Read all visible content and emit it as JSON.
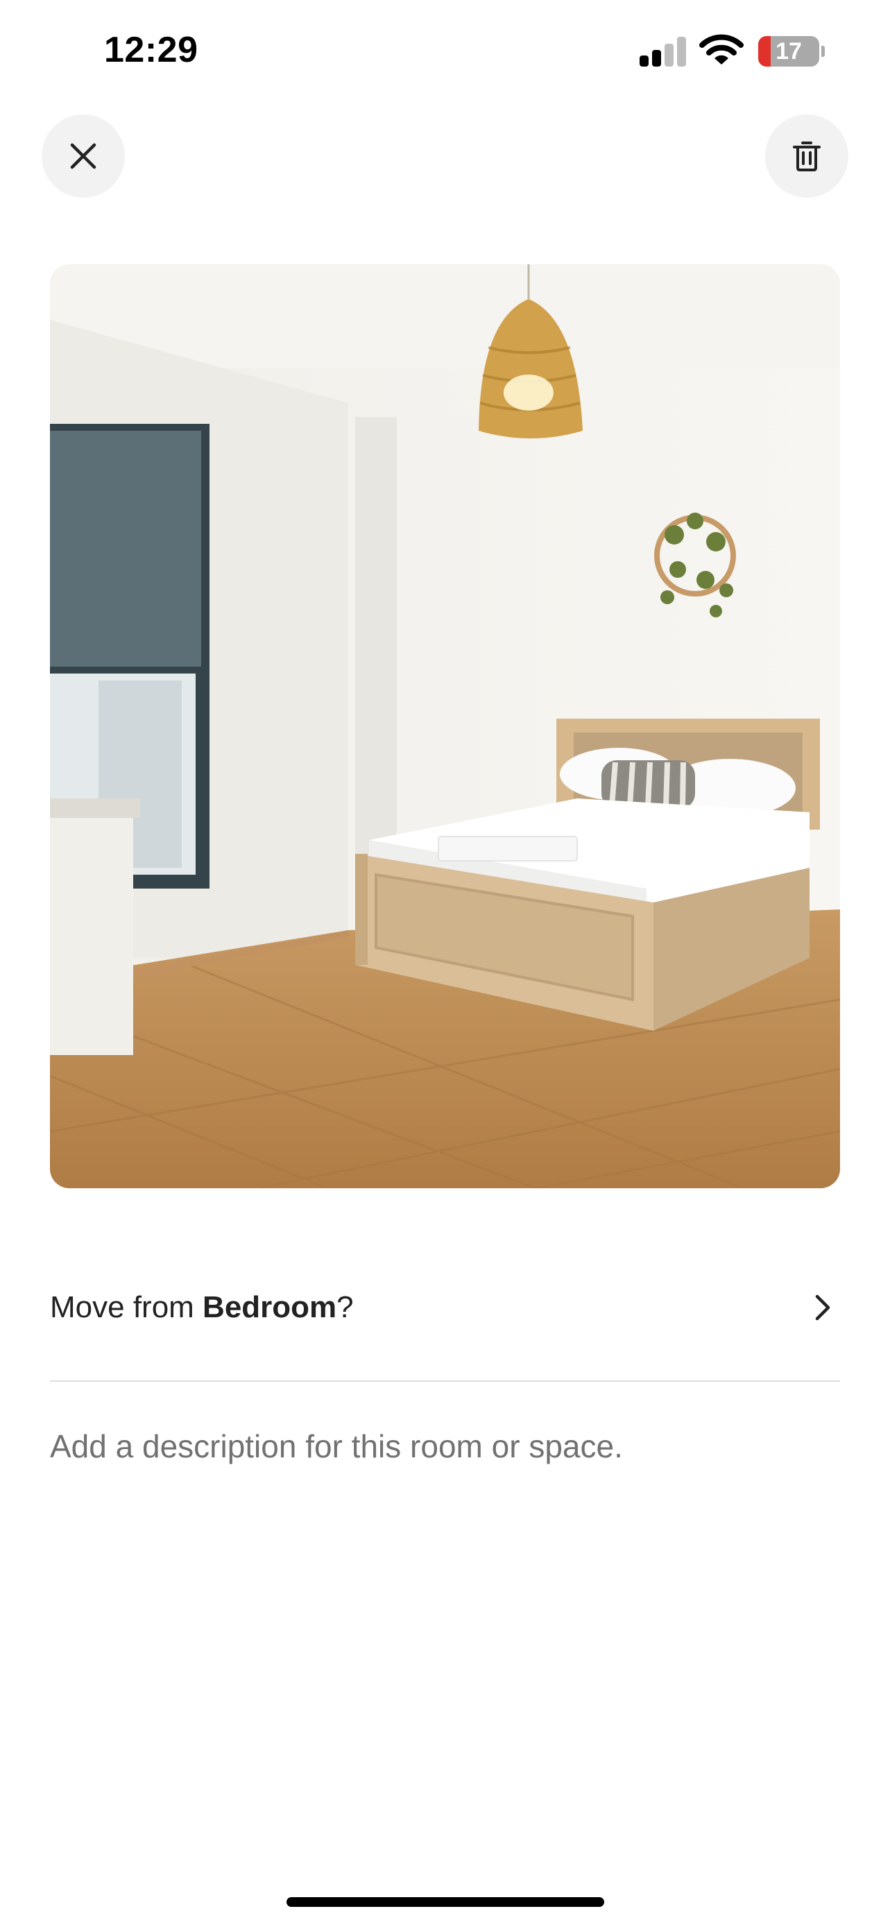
{
  "status_bar": {
    "time": "12:29",
    "battery_level": "17",
    "battery_fraction": 0.17,
    "signal_bars_active": 2,
    "signal_bars_total": 4
  },
  "header": {
    "close_icon": "close-icon",
    "delete_icon": "trash-icon"
  },
  "photo": {
    "subject": "bedroom"
  },
  "move_row": {
    "prefix": "Move from ",
    "room": "Bedroom",
    "suffix": "?",
    "chevron_icon": "chevron-right-icon"
  },
  "description": {
    "placeholder": "Add a description for this room or space."
  },
  "colors": {
    "text_primary": "#222222",
    "text_secondary": "#717171",
    "button_bg": "#f2f2f2",
    "divider": "#dddddd",
    "battery_low": "#e0322b"
  }
}
